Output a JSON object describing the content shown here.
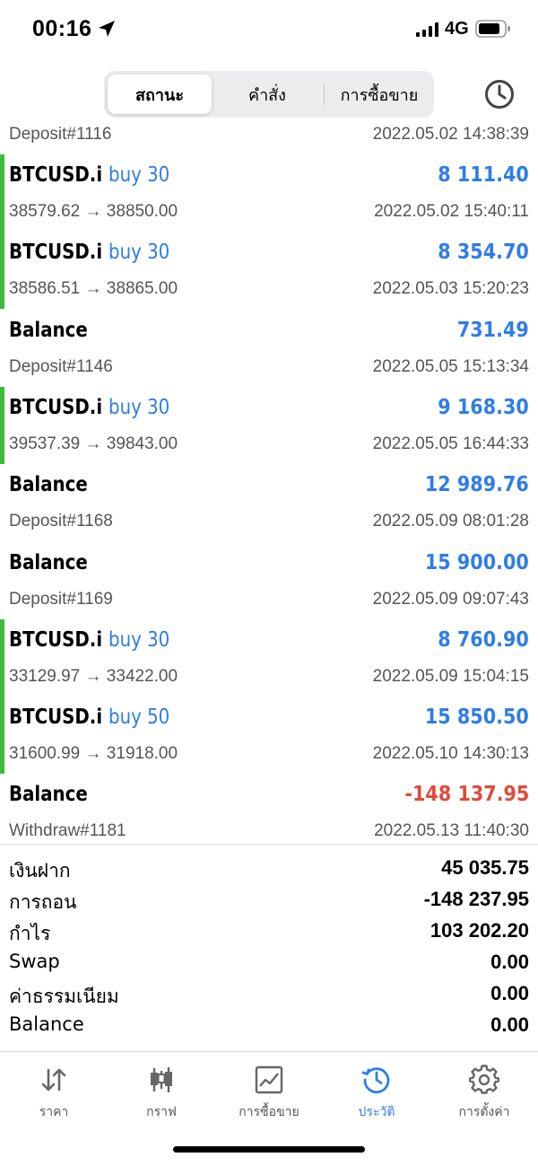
{
  "status_bar": {
    "time": "00:16",
    "network": "4G"
  },
  "segments": [
    {
      "label": "สถานะ",
      "active": true
    },
    {
      "label": "คำสั่ง",
      "active": false
    },
    {
      "label": "การซื้อขาย",
      "active": false
    }
  ],
  "history_icon": "clock-history-icon",
  "partial_row": {
    "left": "Deposit#1116",
    "right": "2022.05.02 14:38:39"
  },
  "rows": [
    {
      "type": "trade",
      "symbol": "BTCUSD.i",
      "side": "buy 30",
      "amount": "8 111.40",
      "prices": "38579.62 → 38850.00",
      "time": "2022.05.02 15:40:11"
    },
    {
      "type": "trade",
      "symbol": "BTCUSD.i",
      "side": "buy 30",
      "amount": "8 354.70",
      "prices": "38586.51 → 38865.00",
      "time": "2022.05.03 15:20:23"
    },
    {
      "type": "balance",
      "symbol": "Balance",
      "side": "",
      "amount": "731.49",
      "prices": "Deposit#1146",
      "time": "2022.05.05 15:13:34"
    },
    {
      "type": "trade",
      "symbol": "BTCUSD.i",
      "side": "buy 30",
      "amount": "9 168.30",
      "prices": "39537.39 → 39843.00",
      "time": "2022.05.05 16:44:33"
    },
    {
      "type": "balance",
      "symbol": "Balance",
      "side": "",
      "amount": "12 989.76",
      "prices": "Deposit#1168",
      "time": "2022.05.09 08:01:28"
    },
    {
      "type": "balance",
      "symbol": "Balance",
      "side": "",
      "amount": "15 900.00",
      "prices": "Deposit#1169",
      "time": "2022.05.09 09:07:43"
    },
    {
      "type": "trade",
      "symbol": "BTCUSD.i",
      "side": "buy 30",
      "amount": "8 760.90",
      "prices": "33129.97 → 33422.00",
      "time": "2022.05.09 15:04:15"
    },
    {
      "type": "trade",
      "symbol": "BTCUSD.i",
      "side": "buy 50",
      "amount": "15 850.50",
      "prices": "31600.99 → 31918.00",
      "time": "2022.05.10 14:30:13"
    },
    {
      "type": "balance",
      "symbol": "Balance",
      "side": "",
      "amount": "-148 137.95",
      "prices": "Withdraw#1181",
      "time": "2022.05.13 11:40:30"
    }
  ],
  "summary": [
    {
      "label": "เงินฝาก",
      "value": "45 035.75"
    },
    {
      "label": "การถอน",
      "value": "-148 237.95"
    },
    {
      "label": "กำไร",
      "value": "103 202.20"
    },
    {
      "label": "Swap",
      "value": "0.00"
    },
    {
      "label": "ค่าธรรมเนียม",
      "value": "0.00"
    },
    {
      "label": "Balance",
      "value": "0.00"
    }
  ],
  "tabs": [
    {
      "label": "ราคา",
      "icon": "quotes-arrows-icon",
      "active": false
    },
    {
      "label": "กราฟ",
      "icon": "candlestick-chart-icon",
      "active": false
    },
    {
      "label": "การซื้อขาย",
      "icon": "trade-chart-icon",
      "active": false
    },
    {
      "label": "ประวัติ",
      "icon": "history-icon",
      "active": true
    },
    {
      "label": "การตั้งค่า",
      "icon": "settings-gear-icon",
      "active": false
    }
  ],
  "colors": {
    "accent": "#2f7de6",
    "negative": "#e04a3b",
    "trade_bar": "#3dbb3a"
  }
}
